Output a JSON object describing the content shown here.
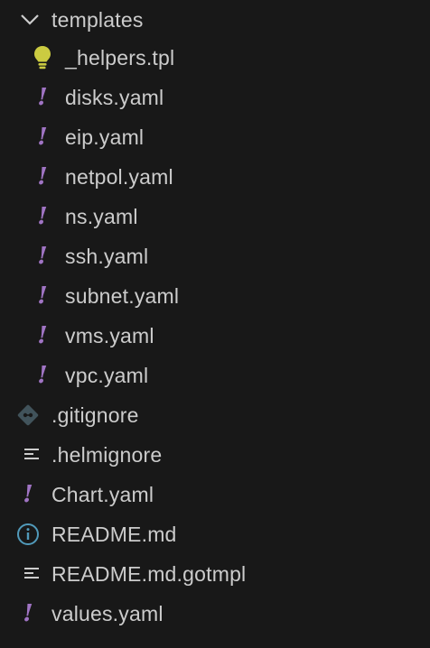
{
  "folder": {
    "name": "templates",
    "expanded": true,
    "icon": "chevron-down-icon",
    "children": [
      {
        "name": "_helpers.tpl",
        "icon": "lightbulb-icon"
      },
      {
        "name": "disks.yaml",
        "icon": "yaml-icon"
      },
      {
        "name": "eip.yaml",
        "icon": "yaml-icon"
      },
      {
        "name": "netpol.yaml",
        "icon": "yaml-icon"
      },
      {
        "name": "ns.yaml",
        "icon": "yaml-icon"
      },
      {
        "name": "ssh.yaml",
        "icon": "yaml-icon"
      },
      {
        "name": "subnet.yaml",
        "icon": "yaml-icon"
      },
      {
        "name": "vms.yaml",
        "icon": "yaml-icon"
      },
      {
        "name": "vpc.yaml",
        "icon": "yaml-icon"
      }
    ]
  },
  "files": [
    {
      "name": ".gitignore",
      "icon": "git-icon"
    },
    {
      "name": ".helmignore",
      "icon": "lines-icon"
    },
    {
      "name": "Chart.yaml",
      "icon": "yaml-icon"
    },
    {
      "name": "README.md",
      "icon": "info-icon"
    },
    {
      "name": "README.md.gotmpl",
      "icon": "lines-icon"
    },
    {
      "name": "values.yaml",
      "icon": "yaml-icon"
    }
  ],
  "colors": {
    "background": "#181818",
    "text": "#cccccc",
    "yaml": "#a074c4",
    "lightbulb": "#cbcb41",
    "git": "#41535b",
    "info": "#519aba",
    "lines": "#cccccc"
  }
}
